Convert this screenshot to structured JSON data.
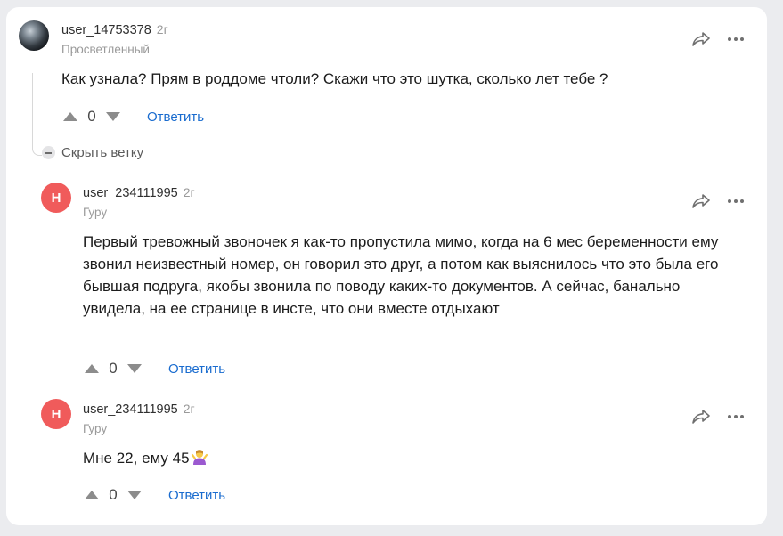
{
  "thread": {
    "hide_branch_label": "Скрыть ветку"
  },
  "comments": [
    {
      "username": "user_14753378",
      "age": "2г",
      "rank": "Просветленный",
      "avatar_type": "photo",
      "text": "Как узнала? Прям в роддоме чтоли? Скажи что это шутка, сколько лет тебе ?",
      "votes": "0",
      "reply_label": "Ответить"
    },
    {
      "username": "user_234111995",
      "age": "2г",
      "rank": "Гуру",
      "avatar_letter": "Н",
      "text": "Первый тревожный звоночек я как-то пропустила мимо, когда на 6 мес беременности ему звонил неизвестный номер, он говорил это друг, а потом как выяснилось что это была его бывшая подруга, якобы звонила по поводу каких-то документов. А сейчас, банально увидела, на ее странице в инсте, что они вместе отдыхают",
      "votes": "0",
      "reply_label": "Ответить"
    },
    {
      "username": "user_234111995",
      "age": "2г",
      "rank": "Гуру",
      "avatar_letter": "Н",
      "text": "Мне 22, ему 45",
      "emoji": "person-shrugging-emoji",
      "votes": "0",
      "reply_label": "Ответить"
    }
  ],
  "colors": {
    "link": "#1a6ccf",
    "avatar_letter_bg": "#f05b5b",
    "page_bg": "#ebecef"
  },
  "icons": [
    "share-icon",
    "more-icon",
    "upvote-icon",
    "downvote-icon",
    "minus-icon"
  ]
}
